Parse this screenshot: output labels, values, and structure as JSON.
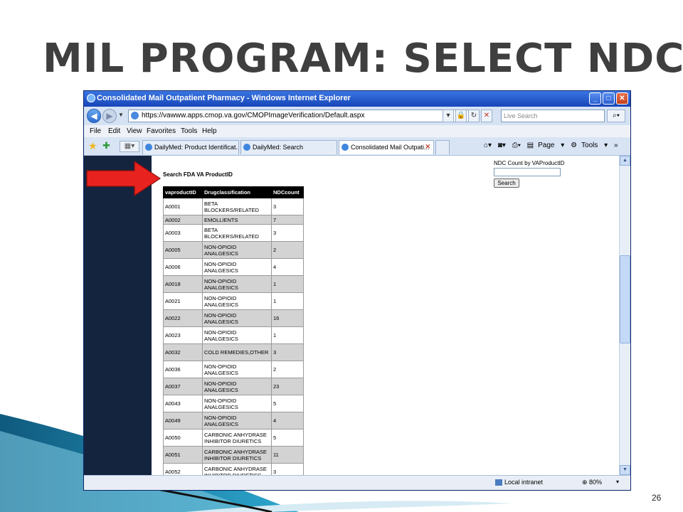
{
  "slide": {
    "title": "MIL PROGRAM: SELECT NDC",
    "page_number": "26"
  },
  "browser": {
    "window_title": "Consolidated Mail Outpatient Pharmacy - Windows Internet Explorer",
    "url": "https://vawww.apps.cmop.va.gov/CMOPImageVerification/Default.aspx",
    "search_placeholder": "Live Search",
    "menu": [
      "File",
      "Edit",
      "View",
      "Favorites",
      "Tools",
      "Help"
    ],
    "tabs": [
      {
        "label": "DailyMed: Product Identificat..."
      },
      {
        "label": "DailyMed: Search"
      },
      {
        "label": "Consolidated Mail Outpati..."
      }
    ],
    "command_bar": {
      "page": "Page",
      "tools": "Tools"
    },
    "status": {
      "zone": "Local intranet",
      "zoom": "80%"
    }
  },
  "page": {
    "search_title": "Search FDA VA ProductID",
    "ndc_label": "NDC Count by VAProductID",
    "ndc_input_value": "",
    "search_button": "Search",
    "table": {
      "headers": [
        "vaproductID",
        "Drugclassification",
        "NDCcount"
      ],
      "rows": [
        [
          "A0001",
          "BETA BLOCKERS/RELATED",
          "3"
        ],
        [
          "A0002",
          "EMOLLIENTS",
          "7"
        ],
        [
          "A0003",
          "BETA BLOCKERS/RELATED",
          "3"
        ],
        [
          "A0005",
          "NON-OPIOID ANALGESICS",
          "2"
        ],
        [
          "A0006",
          "NON-OPIOID ANALGESICS",
          "4"
        ],
        [
          "A0018",
          "NON-OPIOID ANALGESICS",
          "1"
        ],
        [
          "A0021",
          "NON-OPIOID ANALGESICS",
          "1"
        ],
        [
          "A0022",
          "NON-OPIOID ANALGESICS",
          "16"
        ],
        [
          "A0023",
          "NON-OPIOID ANALGESICS",
          "1"
        ],
        [
          "A0032",
          "COLD REMEDIES,OTHER",
          "3"
        ],
        [
          "A0036",
          "NON-OPIOID ANALGESICS",
          "2"
        ],
        [
          "A0037",
          "NON-OPIOID ANALGESICS",
          "23"
        ],
        [
          "A0043",
          "NON-OPIOID ANALGESICS",
          "5"
        ],
        [
          "A0049",
          "NON-OPIOID ANALGESICS",
          "4"
        ],
        [
          "A0050",
          "CARBONIC ANHYDRASE INHIBITOR DIURETICS",
          "5"
        ],
        [
          "A0051",
          "CARBONIC ANHYDRASE INHIBITOR DIURETICS",
          "11"
        ],
        [
          "A0052",
          "CARBONIC ANHYDRASE INHIBITOR DIURETICS",
          "3"
        ]
      ]
    }
  },
  "colors": {
    "arrow": "#e8231f",
    "left_nav": "#14243f",
    "header_row": "#000000",
    "alt_row": "#d3d3d3",
    "title_text": "#3f3f3f"
  }
}
